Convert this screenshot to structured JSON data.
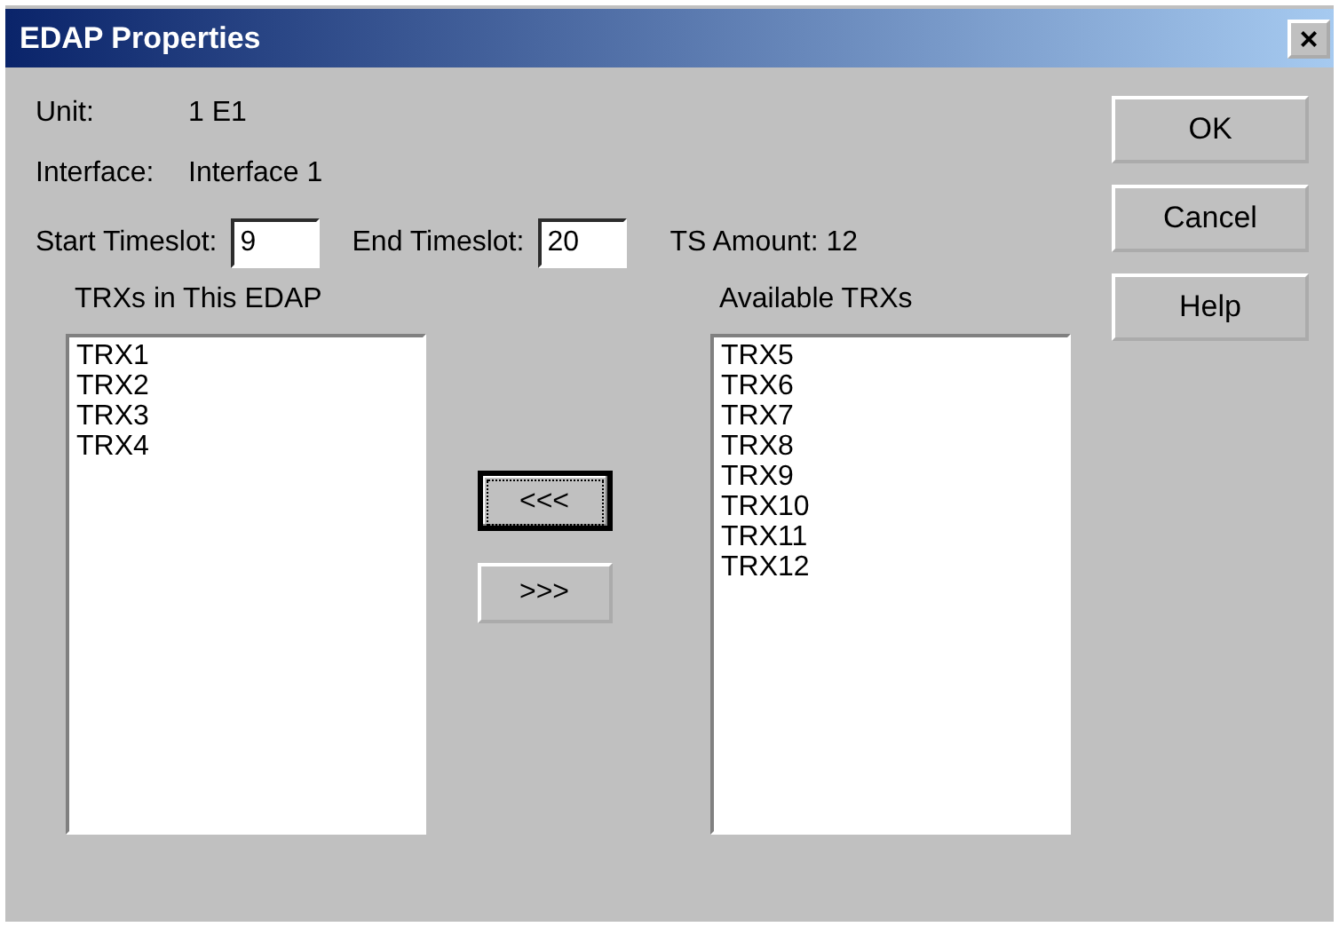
{
  "window": {
    "title": "EDAP Properties",
    "close": "×"
  },
  "info": [
    {
      "label": "Unit:",
      "value": "1 E1"
    },
    {
      "label": "Interface:",
      "value": "Interface 1"
    }
  ],
  "timeslots": {
    "start_label": "Start Timeslot:",
    "start_value": "9",
    "end_label": "End Timeslot:",
    "end_value": "20",
    "amount": "TS Amount: 12"
  },
  "left_list": {
    "title": "TRXs in This EDAP",
    "items": [
      "TRX1",
      "TRX2",
      "TRX3",
      "TRX4"
    ]
  },
  "move_buttons": [
    {
      "label": "<<<",
      "focused": true
    },
    {
      "label": ">>>",
      "focused": false
    }
  ],
  "right_list": {
    "title": "Available TRXs",
    "items": [
      "TRX5",
      "TRX6",
      "TRX7",
      "TRX8",
      "TRX9",
      "TRX10",
      "TRX11",
      "TRX12"
    ]
  },
  "buttons": [
    "OK",
    "Cancel",
    "Help"
  ]
}
